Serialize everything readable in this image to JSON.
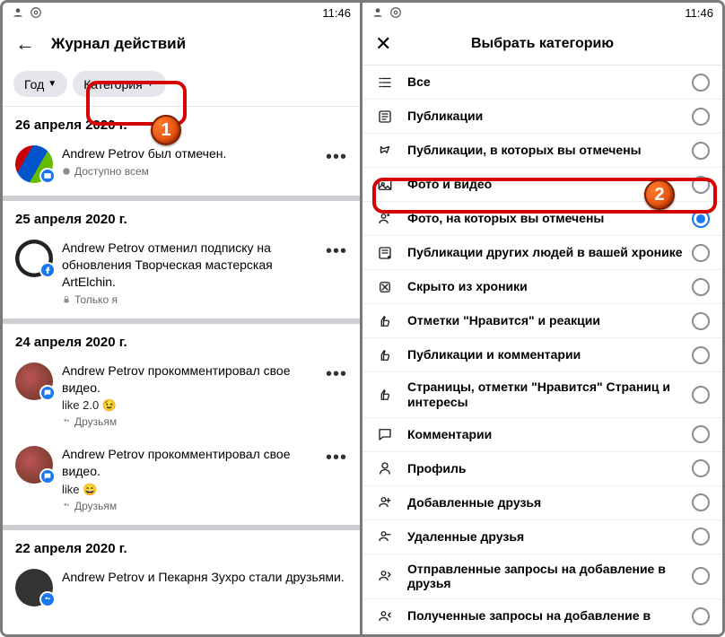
{
  "statusbar": {
    "time": "11:46"
  },
  "left": {
    "header_title": "Журнал действий",
    "filters": {
      "year": "Год",
      "category": "Категория"
    },
    "dates": {
      "d1": "26 апреля 2020 г.",
      "d2": "25 апреля 2020 г.",
      "d3": "24 апреля 2020 г.",
      "d4": "22 апреля 2020 г."
    },
    "entries": {
      "e1": {
        "line": "Andrew Petrov был отмечен.",
        "vis": "Доступно всем"
      },
      "e2": {
        "line": "Andrew Petrov отменил подписку на обновления Творческая мастерская ArtElchin.",
        "vis": "Только я"
      },
      "e3": {
        "line": "Andrew Petrov прокомментировал свое видео.",
        "like": "like 2.0 😉",
        "vis": "Друзьям"
      },
      "e4": {
        "line": "Andrew Petrov прокомментировал свое видео.",
        "like": "like 😄",
        "vis": "Друзьям"
      },
      "e5": {
        "line": "Andrew Petrov и Пекарня Зухро стали друзьями."
      }
    }
  },
  "right": {
    "modal_title": "Выбрать категорию",
    "categories": [
      "Все",
      "Публикации",
      "Публикации, в которых вы отмечены",
      "Фото и видео",
      "Фото, на которых вы отмечены",
      "Публикации других людей в вашей хронике",
      "Скрыто из хроники",
      "Отметки \"Нравится\" и реакции",
      "Публикации и комментарии",
      "Страницы, отметки \"Нравится\" Страниц и интересы",
      "Комментарии",
      "Профиль",
      "Добавленные друзья",
      "Удаленные друзья",
      "Отправленные запросы на добавление в друзья",
      "Полученные запросы на добавление в"
    ],
    "selected_index": 4
  },
  "badges": {
    "b1": "1",
    "b2": "2"
  }
}
